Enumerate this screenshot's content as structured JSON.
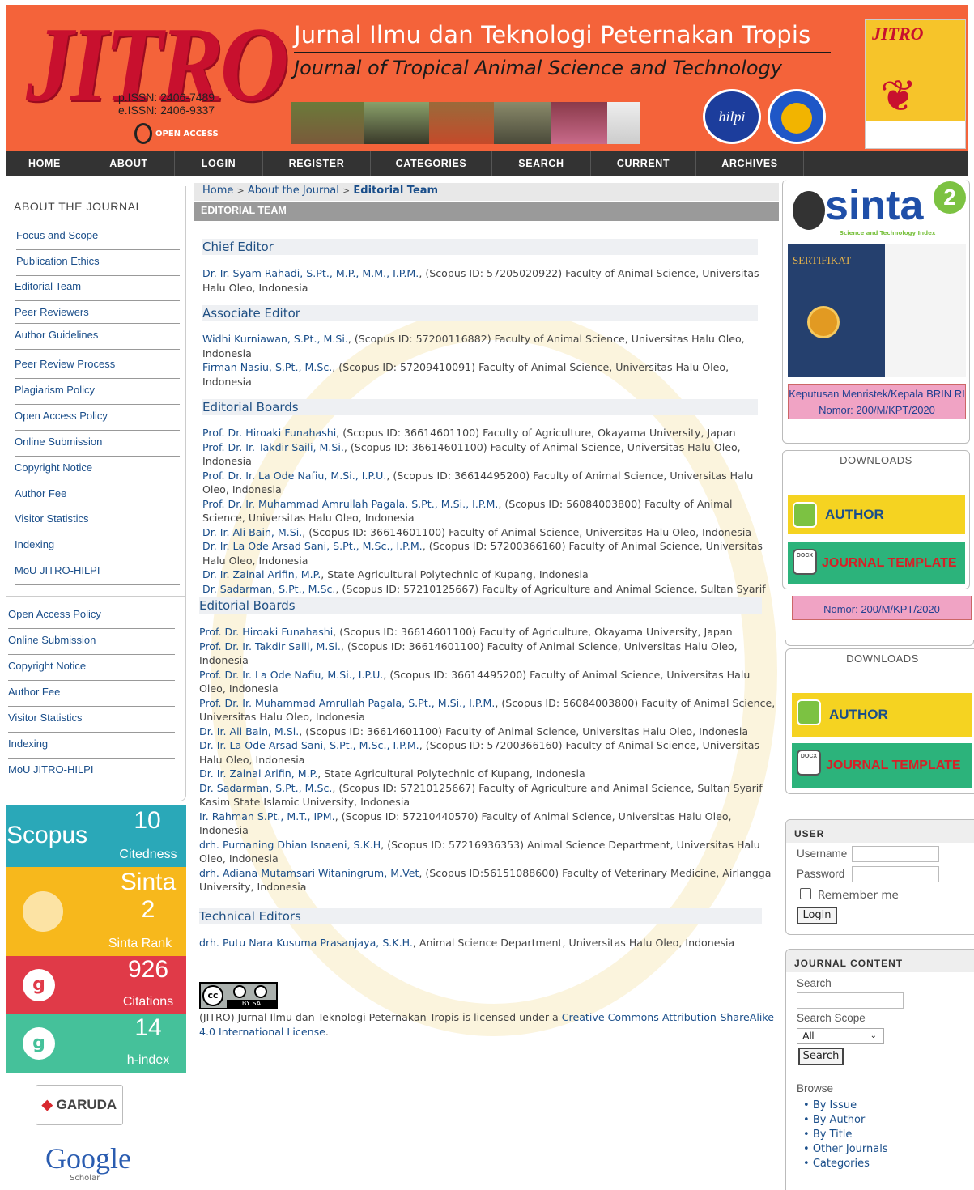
{
  "header": {
    "logo": "JITRO",
    "pissn": "p.ISSN: 2406-7489",
    "eissn": "e.ISSN: 2406-9337",
    "open_access": "OPEN ACCESS",
    "title_id": "Jurnal Ilmu dan Teknologi Peternakan Tropis",
    "title_en": "Journal of Tropical Animal Science and Technology",
    "badge_hilpi": "hilpi",
    "cover_logo": "JITRO"
  },
  "nav": [
    "HOME",
    "ABOUT",
    "LOGIN",
    "REGISTER",
    "CATEGORIES",
    "SEARCH",
    "CURRENT",
    "ARCHIVES"
  ],
  "left": {
    "heading": "ABOUT THE JOURNAL",
    "items": [
      "Focus and Scope",
      "Publication Ethics",
      "Editorial Team",
      "Peer Reviewers",
      "Author Guidelines",
      "Peer Review Process",
      "Plagiarism Policy",
      "Open Access Policy",
      "Online Submission",
      "Copyright Notice",
      "Author Fee",
      "Visitor Statistics",
      "Indexing",
      "MoU JITRO-HILPI"
    ],
    "items2": [
      "Open Access Policy",
      "Online Submission",
      "Copyright Notice",
      "Author Fee",
      "Visitor Statistics",
      "Indexing",
      "MoU JITRO-HILPI"
    ],
    "stats": {
      "scopus_label": "Scopus",
      "scopus_value": "10",
      "scopus_caption": "Citedness",
      "sinta_label": "Sinta",
      "sinta_value": "2",
      "sinta_caption": "Sinta Rank",
      "citations_value": "926",
      "citations_caption": "Citations",
      "hindex_value": "14",
      "hindex_caption": "h-index"
    },
    "garuda": "GARUDA",
    "google": "Google",
    "scholar": "Scholar"
  },
  "breadcrumb": {
    "home": "Home",
    "about": "About the Journal",
    "current": "Editorial Team"
  },
  "page_title": "EDITORIAL TEAM",
  "chief": {
    "heading": "Chief Editor",
    "name": "Dr. Ir. Syam Rahadi, S.Pt., M.P., M.M., I.P.M.",
    "rest": ", (Scopus ID: 57205020922) Faculty of Animal Science, Universitas Halu Oleo, Indonesia"
  },
  "associate": {
    "heading": "Associate Editor",
    "rows": [
      {
        "name": "Widhi Kurniawan, S.Pt., M.Si.",
        "rest": ", (Scopus ID: 57200116882) Faculty of Animal Science, Universitas Halu Oleo, Indonesia"
      },
      {
        "name": "Firman Nasiu, S.Pt., M.Sc.",
        "rest": ", (Scopus ID: 57209410091) Faculty of Animal Science, Universitas Halu Oleo, Indonesia"
      }
    ]
  },
  "boards_heading": "Editorial Boards",
  "boards": [
    {
      "name": "Prof. Dr. Hiroaki Funahashi",
      "rest": ", (Scopus ID: 36614601100) Faculty of Agriculture, Okayama University, Japan"
    },
    {
      "name": "Prof. Dr. Ir. Takdir Saili, M.Si.",
      "rest": ", (Scopus ID: 36614601100) Faculty of Animal Science, Universitas Halu Oleo, Indonesia"
    },
    {
      "name": "Prof. Dr. Ir. La Ode Nafiu, M.Si., I.P.U.",
      "rest": ", (Scopus ID: 36614495200) Faculty of Animal Science, Universitas Halu Oleo, Indonesia"
    },
    {
      "name": "Prof. Dr. Ir. Muhammad Amrullah Pagala, S.Pt., M.Si., I.P.M.",
      "rest": ", (Scopus ID: 56084003800) Faculty of Animal Science, Universitas Halu Oleo, Indonesia"
    },
    {
      "name": "Dr. Ir. Ali Bain, M.Si.",
      "rest": ", (Scopus ID: 36614601100) Faculty of Animal Science, Universitas Halu Oleo, Indonesia"
    },
    {
      "name": "Dr. Ir. La Ode Arsad Sani, S.Pt., M.Sc., I.P.M.",
      "rest": ", (Scopus ID: 57200366160) Faculty of Animal Science, Universitas Halu Oleo, Indonesia"
    },
    {
      "name": "Dr. Ir. Zainal Arifin, M.P.",
      "rest": ", State Agricultural Polytechnic of Kupang, Indonesia"
    },
    {
      "name": "Dr. Sadarman, S.Pt., M.Sc.",
      "rest": ", (Scopus ID: 57210125667) Faculty of Agriculture and Animal Science, Sultan Syarif Kasim State Islamic University, Indonesia"
    },
    {
      "name": "Ir. Rahman S.Pt., M.T., IPM.",
      "rest": ", (Scopus ID: 57210440570) Faculty of Animal Science, Universitas Halu Oleo, Indonesia"
    },
    {
      "name": "drh. Purnaning Dhian Isnaeni, S.K.H",
      "rest": ", (Scopus ID: 57216936353) Animal Science Department, Universitas Halu Oleo, Indonesia"
    },
    {
      "name": "drh. Adiana Mutamsari Witaningrum, M.Vet",
      "rest": ", (Scopus ID:56151088600) Faculty of Veterinary Medicine, Airlangga University, Indonesia"
    }
  ],
  "technical": {
    "heading": "Technical Editors",
    "name": "drh. Putu Nara Kusuma Prasanjaya, S.K.H.",
    "rest": ", Animal Science Department, Universitas Halu Oleo, Indonesia"
  },
  "license": {
    "badge": "BY SA",
    "text": "(JITRO) Jurnal Ilmu dan Teknologi Peternakan Tropis  is licensed under a ",
    "link": "Creative Commons Attribution-ShareAlike 4.0 International License",
    "end": "."
  },
  "right": {
    "sinta_logo": "sinta",
    "sinta_rank": "2",
    "sinta_sub": "Science and Technology Index",
    "cert_title": "SERTIFIKAT",
    "decree1": "Keputusan Menristek/Kepala BRIN RI",
    "decree2": "Nomor: 200/M/KPT/2020",
    "downloads": "DOWNLOADS",
    "author_guidelines": "AUTHOR GUIDELINES",
    "journal_template": "JOURNAL TEMPLATE",
    "docx": "DOCX",
    "user": {
      "heading": "USER",
      "username": "Username",
      "password": "Password",
      "remember": "Remember me",
      "login": "Login"
    },
    "content": {
      "heading": "JOURNAL CONTENT",
      "search": "Search",
      "scope": "Search Scope",
      "scope_value": "All",
      "button": "Search",
      "browse": "Browse",
      "links": [
        "By Issue",
        "By Author",
        "By Title",
        "Other Journals",
        "Categories"
      ]
    }
  }
}
